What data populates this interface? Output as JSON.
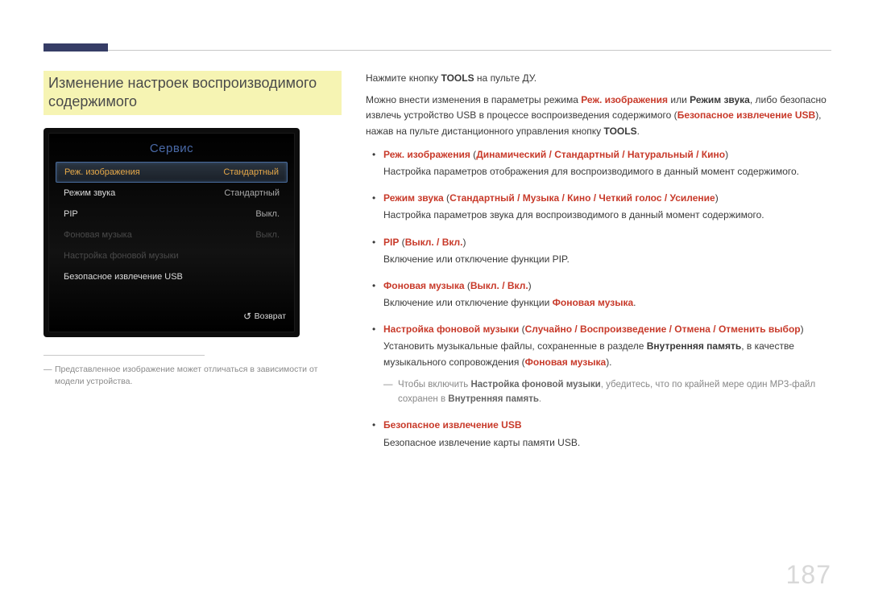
{
  "pageNumber": "187",
  "sectionTitle": "Изменение настроек воспроизводимого содержимого",
  "panel": {
    "title": "Сервис",
    "items": [
      {
        "label": "Реж. изображения",
        "value": "Стандартный",
        "state": "highlight"
      },
      {
        "label": "Режим звука",
        "value": "Стандартный",
        "state": "normal"
      },
      {
        "label": "PIP",
        "value": "Выкл.",
        "state": "normal"
      },
      {
        "label": "Фоновая музыка",
        "value": "Выкл.",
        "state": "disabled"
      },
      {
        "label": "Настройка фоновой музыки",
        "value": "",
        "state": "disabled"
      },
      {
        "label": "Безопасное извлечение USB",
        "value": "",
        "state": "normal"
      }
    ],
    "returnLabel": "Возврат"
  },
  "footNote": "Представленное изображение может отличаться в зависимости от модели устройства.",
  "intro": {
    "line1_pre": "Нажмите кнопку ",
    "line1_bold": "TOOLS",
    "line1_post": " на пульте ДУ.",
    "line2_a": "Можно внести изменения в параметры режима ",
    "line2_b": "Реж. изображения",
    "line2_c": " или ",
    "line2_d": "Режим звука",
    "line2_e": ", либо безопасно извлечь устройство USB в процессе воспроизведения содержимого (",
    "line2_f": "Безопасное извлечение USB",
    "line2_g": "), нажав на пульте дистанционного управления кнопку ",
    "line2_h": "TOOLS",
    "line2_i": "."
  },
  "bullets": [
    {
      "title": "Реж. изображения",
      "sep": " (",
      "optionsHL": "Динамический / Стандартный / Натуральный / Кино",
      "after": ")",
      "desc": "Настройка параметров отображения для воспроизводимого в данный момент содержимого."
    },
    {
      "title": "Режим звука",
      "sep": " (",
      "optionsHL": "Стандартный / Музыка / Кино / Четкий голос / Усиление",
      "after": ")",
      "desc": "Настройка параметров звука для воспроизводимого в данный момент содержимого."
    },
    {
      "title": "PIP",
      "sep": " (",
      "optionsHL": "Выкл. / Вкл.",
      "after": ")",
      "desc": "Включение или отключение функции PIP."
    },
    {
      "title": "Фоновая музыка",
      "sep": " (",
      "optionsHL": "Выкл. / Вкл.",
      "after": ")",
      "desc_a": "Включение или отключение функции ",
      "desc_b": "Фоновая музыка",
      "desc_c": "."
    },
    {
      "title": "Настройка фоновой музыки",
      "sep": " (",
      "optionsHL": "Случайно / Воспроизведение / Отмена / Отменить выбор",
      "after": ")",
      "desc_a": "Установить музыкальные файлы, сохраненные в разделе ",
      "desc_b": "Внутренняя память",
      "desc_c": ", в качестве музыкального сопровождения (",
      "desc_d": "Фоновая музыка",
      "desc_e": ")."
    },
    {
      "title": "Безопасное извлечение USB",
      "desc": "Безопасное извлечение карты памяти USB."
    }
  ],
  "subNote": {
    "a": "Чтобы включить ",
    "b": "Настройка фоновой музыки",
    "c": ", убедитесь, что по крайней мере один MP3-файл сохранен в ",
    "d": "Внутренняя память",
    "e": "."
  }
}
